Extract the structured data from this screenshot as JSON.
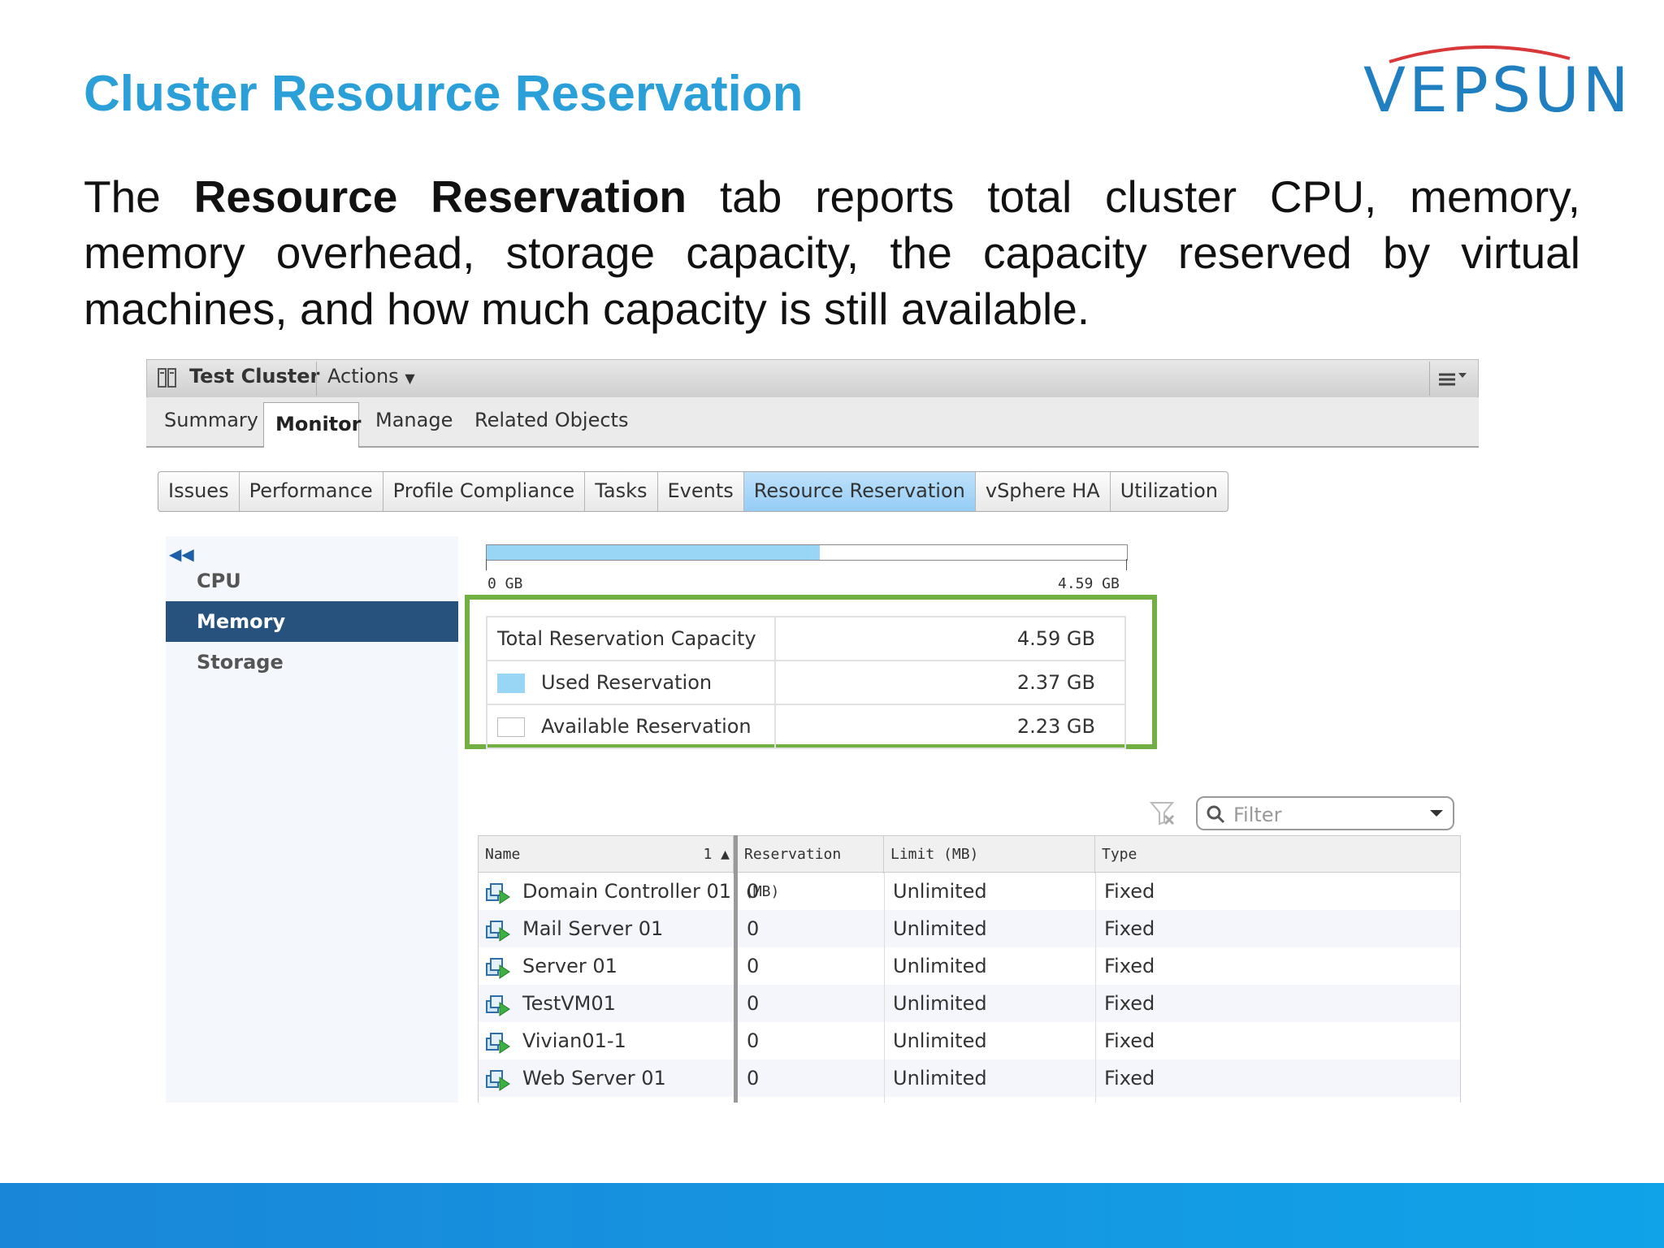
{
  "slide": {
    "title": "Cluster Resource Reservation",
    "logo": "VEPSUN",
    "intro_prefix": "The ",
    "intro_bold": "Resource Reservation",
    "intro_suffix": " tab reports total cluster CPU, memory, memory overhead, storage capacity, the capacity reserved by virtual machines, and how much capacity is still available."
  },
  "window": {
    "object_name": "Test Cluster",
    "actions_label": "Actions",
    "main_tabs": [
      {
        "label": "Summary",
        "active": false
      },
      {
        "label": "Monitor",
        "active": true
      },
      {
        "label": "Manage",
        "active": false
      },
      {
        "label": "Related Objects",
        "active": false
      }
    ],
    "sub_tabs": [
      {
        "label": "Issues",
        "active": false
      },
      {
        "label": "Performance",
        "active": false
      },
      {
        "label": "Profile Compliance",
        "active": false
      },
      {
        "label": "Tasks",
        "active": false
      },
      {
        "label": "Events",
        "active": false
      },
      {
        "label": "Resource Reservation",
        "active": true
      },
      {
        "label": "vSphere HA",
        "active": false
      },
      {
        "label": "Utilization",
        "active": false
      }
    ]
  },
  "sidebar": {
    "items": [
      {
        "label": "CPU",
        "active": false
      },
      {
        "label": "Memory",
        "active": true
      },
      {
        "label": "Storage",
        "active": false
      }
    ]
  },
  "reservation": {
    "bar_min": "0 GB",
    "bar_max": "4.59 GB",
    "used_fraction": 0.52,
    "rows": [
      {
        "label": "Total Reservation Capacity",
        "value": "4.59 GB",
        "swatch": "none"
      },
      {
        "label": "Used Reservation",
        "value": "2.37 GB",
        "swatch": "used"
      },
      {
        "label": "Available Reservation",
        "value": "2.23 GB",
        "swatch": "avail"
      }
    ]
  },
  "filter": {
    "placeholder": "Filter"
  },
  "vm_table": {
    "columns": [
      "Name",
      "Reservation (MB)",
      "Limit (MB)",
      "Type"
    ],
    "sort_indicator": "1 ▲",
    "rows": [
      {
        "name": "Domain Controller 01",
        "reservation": "0",
        "limit": "Unlimited",
        "type": "Fixed"
      },
      {
        "name": "Mail Server 01",
        "reservation": "0",
        "limit": "Unlimited",
        "type": "Fixed"
      },
      {
        "name": "Server 01",
        "reservation": "0",
        "limit": "Unlimited",
        "type": "Fixed"
      },
      {
        "name": "TestVM01",
        "reservation": "0",
        "limit": "Unlimited",
        "type": "Fixed"
      },
      {
        "name": "Vivian01-1",
        "reservation": "0",
        "limit": "Unlimited",
        "type": "Fixed"
      },
      {
        "name": "Web Server 01",
        "reservation": "0",
        "limit": "Unlimited",
        "type": "Fixed"
      }
    ]
  },
  "colors": {
    "title": "#2a9fd8",
    "selected_nav": "#28527e",
    "used_bar": "#99d5f4",
    "highlight_border": "#72b043"
  }
}
